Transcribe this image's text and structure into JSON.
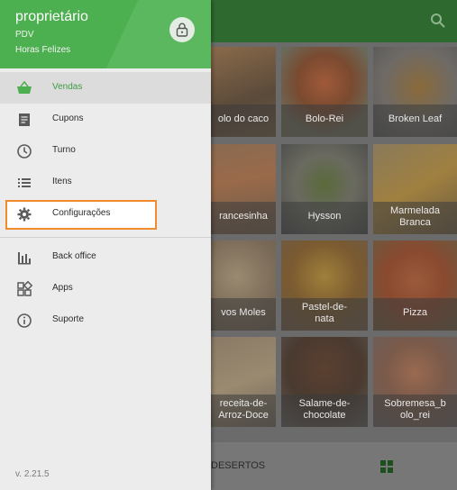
{
  "drawer": {
    "user_name": "proprietário",
    "pdv": "PDV",
    "store": "Horas Felizes",
    "version": "v. 2.21.5",
    "menu": [
      {
        "label": "Vendas",
        "icon": "basket-icon"
      },
      {
        "label": "Cupons",
        "icon": "receipt-icon"
      },
      {
        "label": "Turno",
        "icon": "clock-icon"
      },
      {
        "label": "Itens",
        "icon": "list-icon"
      },
      {
        "label": "Configurações",
        "icon": "gear-icon"
      },
      {
        "label": "Back office",
        "icon": "bar-chart-icon"
      },
      {
        "label": "Apps",
        "icon": "apps-icon"
      },
      {
        "label": "Suporte",
        "icon": "info-icon"
      }
    ]
  },
  "products": [
    {
      "name": "olo do caco"
    },
    {
      "name": "Bolo-Rei"
    },
    {
      "name": "Broken Leaf"
    },
    {
      "name": "rancesinha"
    },
    {
      "name": "Hysson"
    },
    {
      "name": "Marmelada\nBranca"
    },
    {
      "name": "vos Moles"
    },
    {
      "name": "Pastel-de-\nnata"
    },
    {
      "name": "Pizza"
    },
    {
      "name": "receita-de-\nArroz-Doce"
    },
    {
      "name": "Salame-de-\nchocolate"
    },
    {
      "name": "Sobremesa_b\nolo_rei"
    }
  ],
  "bottom": {
    "category": "DESERTOS"
  },
  "colors": {
    "primary": "#4caf50",
    "accent": "#f08c2e"
  }
}
